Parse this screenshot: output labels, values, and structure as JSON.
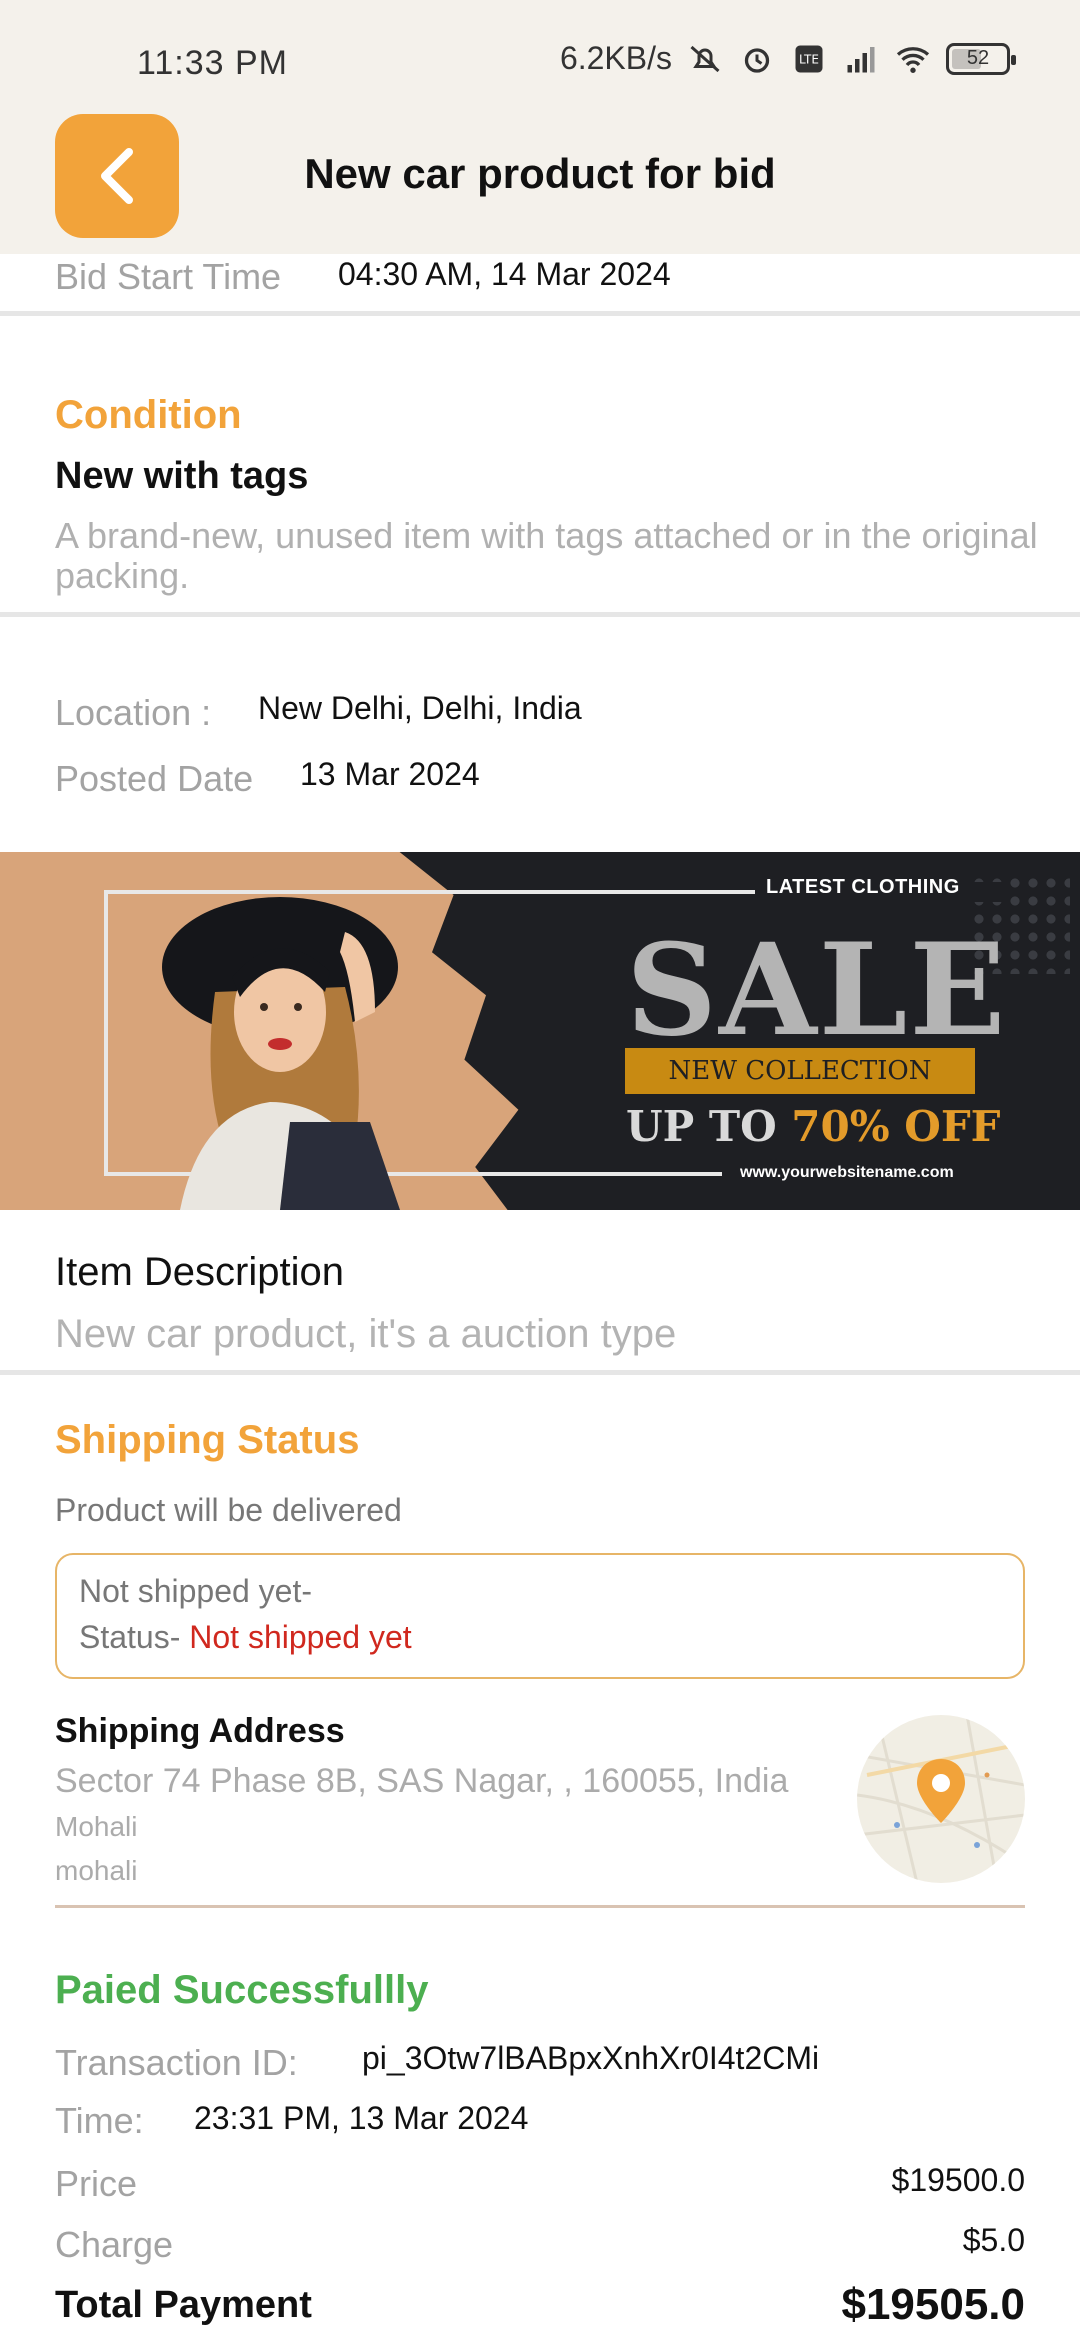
{
  "status_bar": {
    "time": "11:33 PM",
    "network_speed": "6.2KB/s",
    "battery": "52",
    "icons": [
      "mute-icon",
      "alarm-icon",
      "volte-icon",
      "signal-icon",
      "wifi-icon",
      "battery-icon"
    ]
  },
  "header": {
    "title": "New car product for bid",
    "back_icon": "chevron-left-icon",
    "accent_color": "#f2a33a"
  },
  "bid": {
    "start_label": "Bid Start Time",
    "start_value": "04:30 AM, 14 Mar 2024"
  },
  "condition": {
    "heading": "Condition",
    "value": "New with tags",
    "description": "A brand-new, unused item with tags attached or in the original packing."
  },
  "meta": {
    "location_label": "Location :",
    "location_value": "New Delhi, Delhi, India",
    "posted_label": "Posted Date",
    "posted_value": "13 Mar 2024"
  },
  "banner": {
    "tag": "LATEST CLOTHING",
    "headline": "SALE",
    "collection": "NEW COLLECTION",
    "offer_prefix": "UP TO ",
    "offer_highlight": "70% OFF",
    "site": "www.yourwebsitename.com"
  },
  "item": {
    "heading": "Item Description",
    "description": "New car product, it's a auction type"
  },
  "shipping": {
    "heading": "Shipping Status",
    "subtitle": "Product will be delivered",
    "box_line1": "Not shipped yet-",
    "status_prefix": "Status- ",
    "status_value": "Not shipped yet",
    "status_color": "#d0281e",
    "address_heading": "Shipping Address",
    "address_line": "Sector 74 Phase 8B, SAS Nagar, , 160055, India",
    "city": "Mohali",
    "city_lower": "mohali",
    "map_icon": "map-pin-icon"
  },
  "payment": {
    "heading": "Paied Successfullly",
    "heading_color": "#4caf50",
    "transaction_label": "Transaction ID:",
    "transaction_value": "pi_3Otw7lBABpxXnhXr0I4t2CMi",
    "time_label": "Time:",
    "time_value": "23:31 PM, 13 Mar 2024",
    "price_label": "Price",
    "price_value": "$19500.0",
    "charge_label": "Charge",
    "charge_value": "$5.0",
    "total_label": "Total Payment",
    "total_value": "$19505.0"
  }
}
